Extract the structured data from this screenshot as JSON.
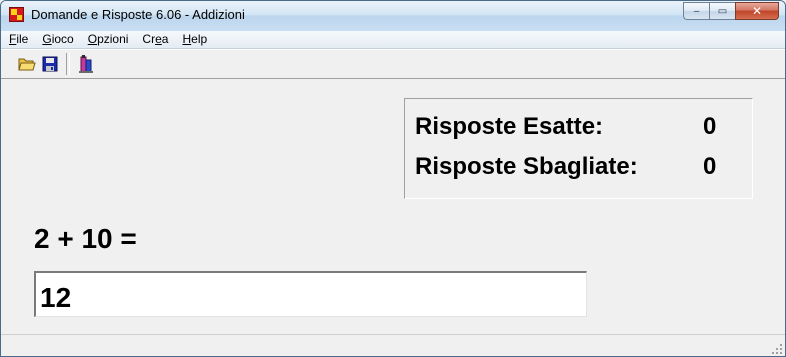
{
  "window": {
    "title": "Domande e Risposte 6.06 - Addizioni",
    "buttons": {
      "minimize": "‒",
      "maximize": "▭",
      "close": "✕"
    }
  },
  "menu": {
    "items": [
      {
        "accel": "F",
        "rest": "ile"
      },
      {
        "accel": "G",
        "rest": "ioco"
      },
      {
        "accel": "O",
        "rest": "pzioni"
      },
      {
        "pre": "Cr",
        "accel": "e",
        "rest": "a"
      },
      {
        "accel": "H",
        "rest": "elp"
      }
    ]
  },
  "toolbar": {
    "icons": [
      "open-folder-icon",
      "save-disk-icon",
      "info-icon"
    ]
  },
  "score": {
    "correct_label": "Risposte Esatte:",
    "correct_value": "0",
    "wrong_label": "Risposte Sbagliate:",
    "wrong_value": "0"
  },
  "quiz": {
    "question": "2 + 10 =",
    "answer": "12"
  }
}
